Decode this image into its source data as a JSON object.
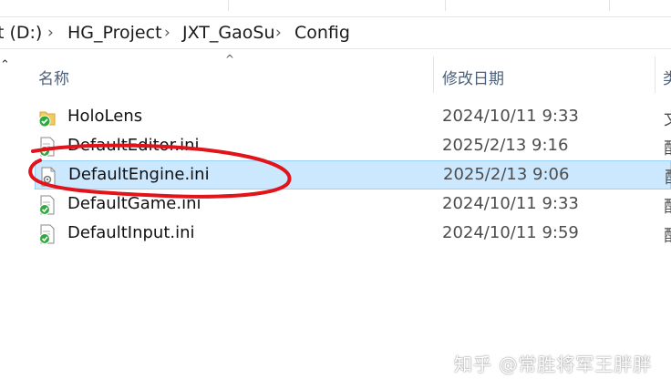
{
  "breadcrumb": {
    "items": [
      "t (D:)",
      "HG_Project",
      "JXT_GaoSu",
      "Config"
    ]
  },
  "columns": {
    "name": "名称",
    "modified": "修改日期",
    "type": "类"
  },
  "files": [
    {
      "name": "HoloLens",
      "modified": "2024/10/11 9:33",
      "type": "文",
      "icon": "folder-sync-icon"
    },
    {
      "name": "DefaultEditor.ini",
      "modified": "2025/2/13 9:16",
      "type": "配",
      "icon": "ini-file-synced-icon"
    },
    {
      "name": "DefaultEngine.ini",
      "modified": "2025/2/13 9:06",
      "type": "配",
      "icon": "ini-file-settings-icon",
      "selected": true
    },
    {
      "name": "DefaultGame.ini",
      "modified": "2024/10/11 9:33",
      "type": "配",
      "icon": "ini-file-synced-icon"
    },
    {
      "name": "DefaultInput.ini",
      "modified": "2024/10/11 9:59",
      "type": "配",
      "icon": "ini-file-synced-icon"
    }
  ],
  "watermark": "知乎 @常胜将军王胖胖",
  "colors": {
    "selection": "#cce8ff",
    "annotation": "#e0141a",
    "sync_green": "#2eaa3c"
  }
}
